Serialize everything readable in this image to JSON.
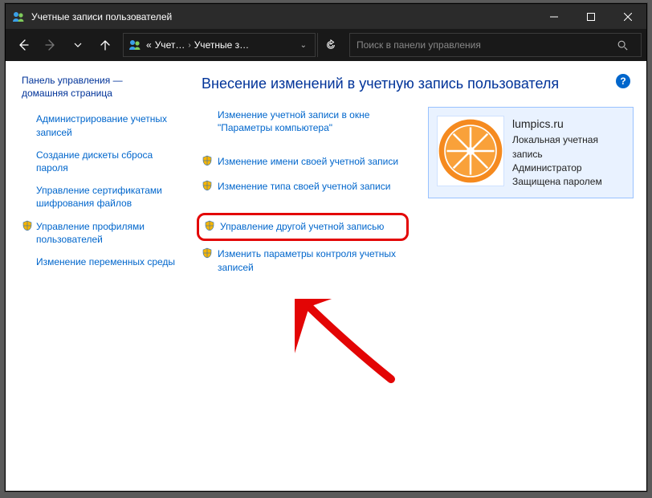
{
  "window": {
    "title": "Учетные записи пользователей",
    "controls": {
      "min": "—",
      "max": "▢",
      "close": "✕"
    }
  },
  "navbar": {
    "breadcrumb_prefix": "«",
    "bc1": "Учет…",
    "bc2": "Учетные з…",
    "search_placeholder": "Поиск в панели управления"
  },
  "sidebar": {
    "home_line1": "Панель управления —",
    "home_line2": "домашняя страница",
    "items": [
      {
        "label": "Администрирование учетных записей",
        "shield": false
      },
      {
        "label": "Создание дискеты сброса пароля",
        "shield": false
      },
      {
        "label": "Управление сертификатами шифрования файлов",
        "shield": false
      },
      {
        "label": "Управление профилями пользователей",
        "shield": true
      },
      {
        "label": "Изменение переменных среды",
        "shield": false
      }
    ]
  },
  "main": {
    "title": "Внесение изменений в учетную запись пользователя",
    "link_pc_settings": "Изменение учетной записи в окне \"Параметры компьютера\"",
    "link_change_name": "Изменение имени своей учетной записи",
    "link_change_type": "Изменение типа своей учетной записи",
    "link_manage_other": "Управление другой учетной записью",
    "link_uac": "Изменить параметры контроля учетных записей"
  },
  "user": {
    "name": "lumpics.ru",
    "type": "Локальная учетная запись",
    "role": "Администратор",
    "protection": "Защищена паролем"
  },
  "help": "?"
}
